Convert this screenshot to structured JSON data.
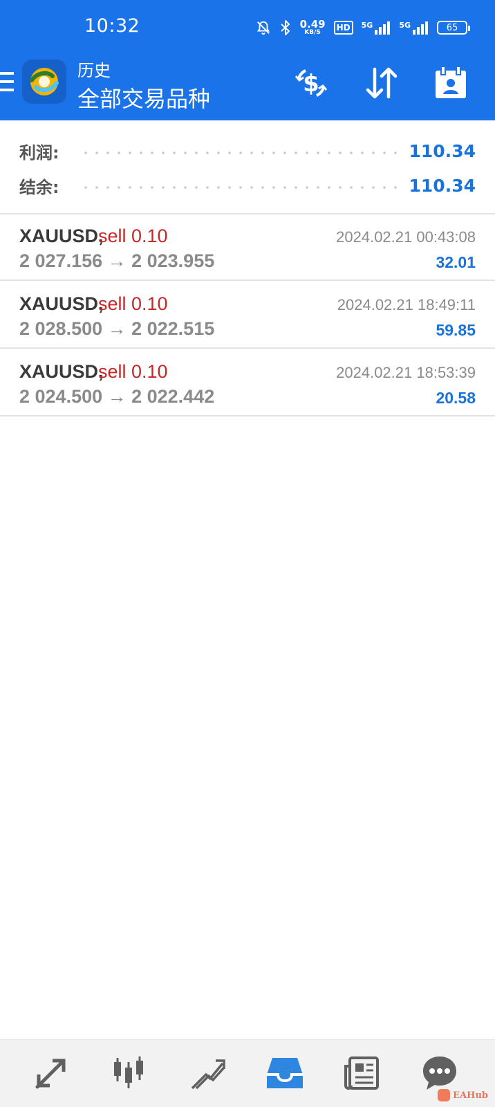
{
  "status_bar": {
    "time": "10:32",
    "net_speed": "0.49",
    "net_unit": "KB/S",
    "hd_label": "HD",
    "network_1": "5G",
    "network_2": "5G",
    "battery": "65"
  },
  "app_bar": {
    "title": "历史",
    "subtitle": "全部交易品种",
    "icons": [
      "menu-icon",
      "app-logo-icon",
      "currency-exchange-icon",
      "sort-icon",
      "calendar-icon"
    ]
  },
  "summary": {
    "profit_label": "利润:",
    "profit_value": "110.34",
    "balance_label": "结余:",
    "balance_value": "110.34"
  },
  "deals": [
    {
      "symbol": "XAUUSD,",
      "type": "sell 0.10",
      "prices": "2 027.156 → 2 023.955",
      "time": "2024.02.21 00:43:08",
      "profit": "32.01"
    },
    {
      "symbol": "XAUUSD,",
      "type": "sell 0.10",
      "prices": "2 028.500 → 2 022.515",
      "time": "2024.02.21 18:49:11",
      "profit": "59.85"
    },
    {
      "symbol": "XAUUSD,",
      "type": "sell 0.10",
      "prices": "2 024.500 → 2 022.442",
      "time": "2024.02.21 18:53:39",
      "profit": "20.58"
    }
  ],
  "bottom_nav": {
    "items": [
      "quotes-icon",
      "chart-icon",
      "trade-icon",
      "history-icon",
      "news-icon",
      "chat-icon"
    ],
    "active": "history-icon"
  },
  "watermark": "EAHub",
  "colors": {
    "brand_blue": "#1a73e8",
    "profit_blue": "#1a73d9",
    "sell_red": "#c62828",
    "muted_gray": "#8a8a8a"
  }
}
